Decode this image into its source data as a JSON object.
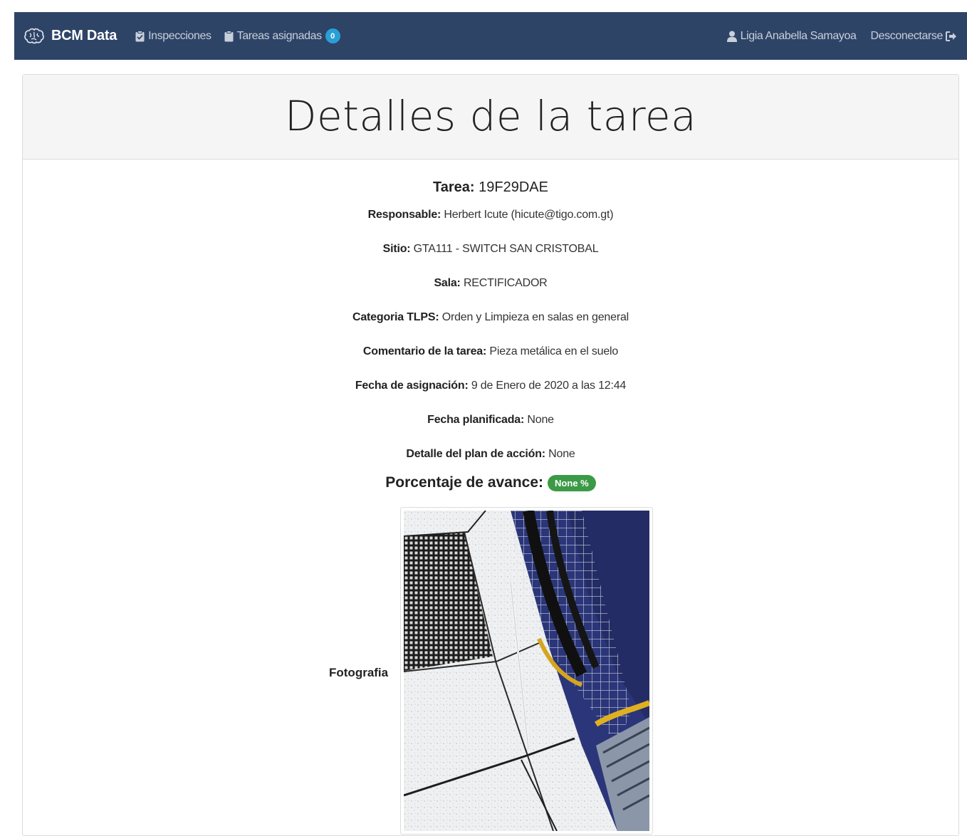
{
  "navbar": {
    "brand": "BCM Data",
    "links": [
      {
        "label": "Inspecciones",
        "icon": "clipboard-check-icon"
      },
      {
        "label": "Tareas asignadas",
        "icon": "clipboard-icon",
        "badge": "0"
      }
    ],
    "user": {
      "label": "Ligia Anabella Samayoa",
      "icon": "user-icon"
    },
    "logout": {
      "label": "Desconectarse",
      "icon": "sign-out-icon"
    },
    "brand_icon": "brain-icon",
    "colors": {
      "background": "#2e4467",
      "badge": "#2a9fd6"
    }
  },
  "page": {
    "heading": "Detalles de la tarea"
  },
  "task": {
    "title_label": "Tarea:",
    "title_value": "19F29DAE",
    "fields": [
      {
        "label": "Responsable:",
        "value": "Herbert Icute (hicute@tigo.com.gt)"
      },
      {
        "label": "Sitio:",
        "value": "GTA111 - SWITCH SAN CRISTOBAL"
      },
      {
        "label": "Sala:",
        "value": "RECTIFICADOR"
      },
      {
        "label": "Categoria TLPS:",
        "value": "Orden y Limpieza en salas en general"
      },
      {
        "label": "Comentario de la tarea:",
        "value": "Pieza metálica en el suelo"
      },
      {
        "label": "Fecha de asignación:",
        "value": "9 de Enero de 2020 a las 12:44"
      },
      {
        "label": "Fecha planificada:",
        "value": "None"
      },
      {
        "label": "Detalle del plan de acción:",
        "value": "None"
      }
    ],
    "progress_label": "Porcentaje de avance:",
    "progress_value": "None %",
    "progress_color": "#3c9a47",
    "photo_label": "Fotografia"
  }
}
